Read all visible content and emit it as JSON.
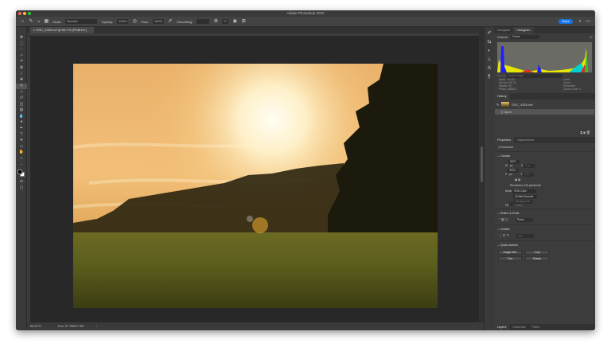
{
  "app": {
    "title": "Adobe Photoshop 2022",
    "share_label": "Share"
  },
  "options_bar": {
    "brush_size": "29",
    "mode_label": "Mode:",
    "mode_value": "Normal",
    "opacity_label": "Opacity:",
    "opacity_value": "100%",
    "flow_label": "Flow:",
    "flow_value": "100%",
    "smoothing_label": "Smoothing:",
    "angle_value": "0°"
  },
  "document": {
    "tab_label": "DSC_4359.nef @ 66.7% (RGB/16*)",
    "zoom": "66.67%",
    "doc_size": "Doc: 57.9M/57.9M"
  },
  "histogram": {
    "tabs": [
      "Navigator",
      "Histogram"
    ],
    "channel_label": "Channel:",
    "channel_value": "Colors",
    "source_label": "Source:",
    "source_value": "Entire Image",
    "stats": {
      "mean": "Mean: 114.63",
      "std_dev": "Std Dev: 80.31",
      "median": "Median: 81",
      "pixels": "Pixels: 168816",
      "level": "Level:",
      "count": "Count:",
      "percentile": "Percentile:",
      "cache_level": "Cache Level: 4"
    }
  },
  "history": {
    "title": "History",
    "snapshot": "DSC_4359.nef",
    "items": [
      "Open"
    ]
  },
  "properties": {
    "tabs": [
      "Properties",
      "Adjustments"
    ],
    "kind": "Document",
    "canvas_section": "Canvas",
    "w_label": "W",
    "w_value": "5872 px",
    "h_label": "H",
    "h_value": "3920 px",
    "x_label": "X",
    "x_value": "0 px",
    "y_label": "Y",
    "y_value": "0 px",
    "resolution": "Resolution: 240 pixels/inch",
    "mode_label": "Mode",
    "mode_value": "RGB Color",
    "depth_value": "16 Bits/Channel",
    "fill_label": "Fill",
    "fill_value": "Background Color",
    "rulers_section": "Rulers & Grids",
    "units_value": "Pixels",
    "guides_section": "Guides",
    "quick_actions_section": "Quick Actions",
    "buttons": [
      "Image Size",
      "Crop",
      "Trim",
      "Rotate"
    ]
  },
  "bottom_tabs": [
    "Layers",
    "Channels",
    "Paths"
  ],
  "colors": {
    "accent": "#1473e6",
    "panel": "#3c3c3c",
    "workspace": "#282828"
  }
}
